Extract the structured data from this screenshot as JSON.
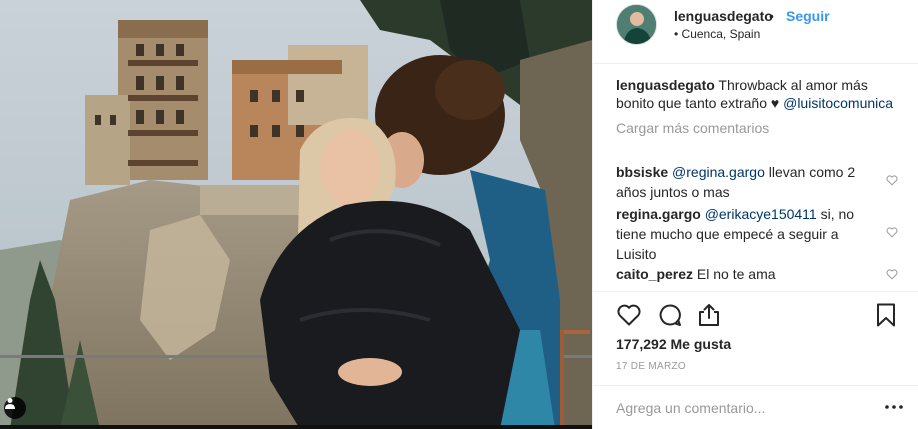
{
  "post": {
    "author": "lenguasdegato",
    "separator": "•",
    "follow_label": "Seguir",
    "location": "• Cuenca, Spain"
  },
  "caption": {
    "user": "lenguasdegato",
    "text": " Throwback al amor más bonito que tanto extraño ♥ ",
    "mention": "@luisitocomunica"
  },
  "load_more_label": "Cargar más comentarios",
  "comments": [
    {
      "user": "bbsiske",
      "mention": "@regina.gargo",
      "text": " llevan como 2 años juntos o mas"
    },
    {
      "user": "regina.gargo",
      "mention": "@erikacye150411",
      "text": " si, no tiene mucho que empecé a seguir a Luisito"
    },
    {
      "user": "caito_perez",
      "mention": "",
      "text": " El no te ama"
    }
  ],
  "likes_text": "177,292 Me gusta",
  "date_text": "17 DE MARZO",
  "add_comment": {
    "placeholder": "Agrega un comentario..."
  },
  "icons": {
    "like": "heart-outline-icon",
    "comment": "speech-bubble-icon",
    "share": "share-upload-icon",
    "save": "bookmark-icon",
    "options": "more-options-icon",
    "tagged": "user-tag-icon"
  },
  "colors": {
    "follow": "#3897f0",
    "mention": "#003569",
    "muted": "#999999",
    "text": "#262626",
    "divider": "#efefef"
  }
}
